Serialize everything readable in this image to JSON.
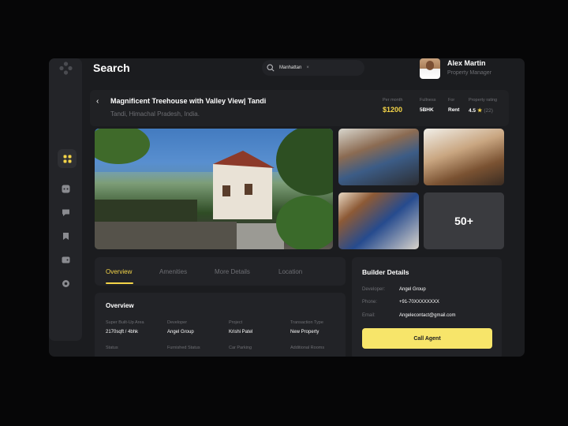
{
  "header": {
    "title": "Search",
    "search_value": "Manhattan"
  },
  "user": {
    "name": "Alex Martin",
    "role": "Property Manager"
  },
  "property": {
    "name": "Magnificent Treehouse with Valley View| Tandi",
    "location": "Tandi, Himachal Pradesh, India.",
    "stats": {
      "per_month_label": "Per month",
      "per_month_value": "$1200",
      "fullness_label": "Fullness",
      "fullness_value": "5BHK",
      "for_label": "For",
      "for_value": "Rent",
      "rating_label": "Property rating",
      "rating_value": "4.5",
      "rating_count": "(22)"
    }
  },
  "gallery": {
    "more_label": "50+"
  },
  "tabs": [
    "Overview",
    "Amenities",
    "More Details",
    "Location"
  ],
  "overview": {
    "title": "Overview",
    "fields": [
      {
        "label": "Super Built-Up Area",
        "value": "2170sqft / 4bhk"
      },
      {
        "label": "Developer",
        "value": "Angel Group"
      },
      {
        "label": "Project",
        "value": "Krishi Patel"
      },
      {
        "label": "Transaction Type",
        "value": "New Property"
      },
      {
        "label": "Status",
        "value": ""
      },
      {
        "label": "Furnished Status",
        "value": ""
      },
      {
        "label": "Car Parking",
        "value": ""
      },
      {
        "label": "Additional Rooms",
        "value": ""
      }
    ]
  },
  "builder": {
    "title": "Builder Details",
    "developer_label": "Developer:",
    "developer_value": "Angel Group",
    "phone_label": "Phone:",
    "phone_value": "+91-70XXXXXXXX",
    "email_label": "Email:",
    "email_value": "Angelecontact@gmail.com",
    "call_label": "Call Agent"
  },
  "colors": {
    "accent": "#f4d448",
    "button": "#f7e56a",
    "surface": "#222327",
    "background": "#1b1c1f"
  }
}
